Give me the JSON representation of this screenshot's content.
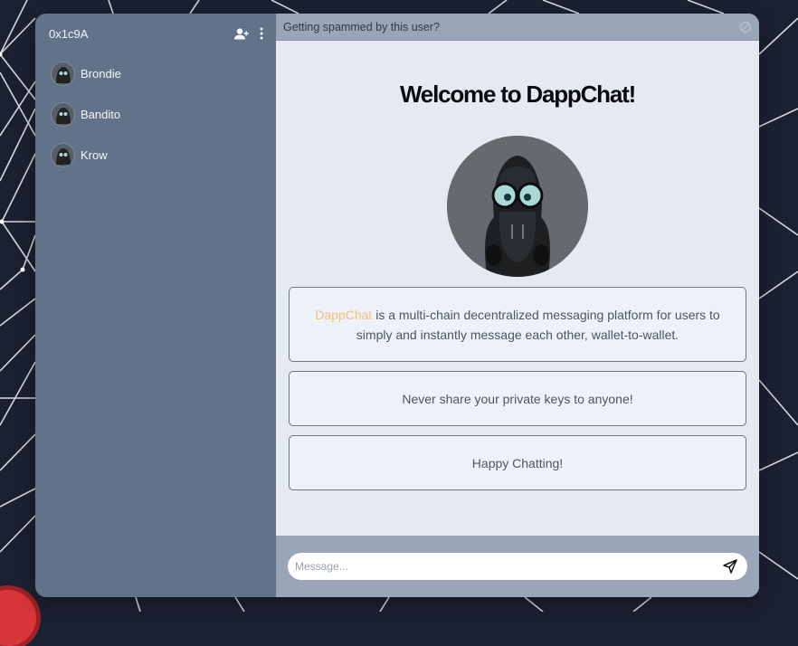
{
  "sidebar": {
    "account": "0x1c9A",
    "icons": {
      "add_contact": "add-user-icon",
      "menu": "vertical-dots-icon"
    },
    "contacts": [
      {
        "name": "Brondie"
      },
      {
        "name": "Bandito"
      },
      {
        "name": "Krow"
      }
    ]
  },
  "top_bar": {
    "text": "Getting spammed by this user?",
    "icon": "block-icon"
  },
  "welcome": {
    "title": "Welcome to DappChat!",
    "cards": [
      {
        "brand": "DappChat",
        "text": " is a multi-chain decentralized messaging platform for users to simply and instantly message each other, wallet-to-wallet."
      },
      {
        "text": "Never share your private keys to anyone!"
      },
      {
        "text": "Happy Chatting!"
      }
    ]
  },
  "composer": {
    "placeholder": "Message...",
    "value": "",
    "send_icon": "send-icon"
  },
  "colors": {
    "sidebar": "#627389",
    "main": "#e4e9f2",
    "bars": "#9aa6b8",
    "brand": "#f3c07a",
    "background": "#1c2132"
  }
}
